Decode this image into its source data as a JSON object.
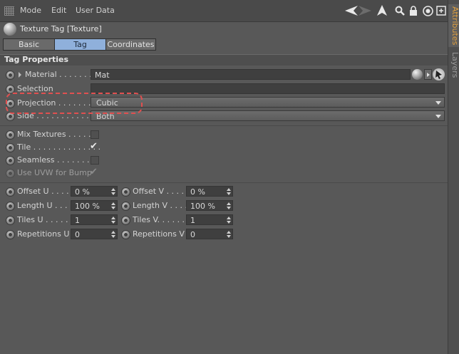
{
  "menubar": {
    "items": [
      "Mode",
      "Edit",
      "User Data"
    ]
  },
  "toolbar_icons": [
    "back-arrow-icon",
    "forward-arrow-icon",
    "cursor-up-icon",
    "search-icon",
    "lock-icon",
    "target-icon",
    "new-window-icon"
  ],
  "sidetabs": {
    "attributes": "Attributes",
    "layers": "Layers"
  },
  "header": {
    "title": "Texture Tag [Texture]"
  },
  "tabs": [
    {
      "label": "Basic"
    },
    {
      "label": "Tag",
      "active": true
    },
    {
      "label": "Coordinates"
    }
  ],
  "section": {
    "title": "Tag Properties"
  },
  "material": {
    "label": "Material . . . . . . .",
    "value": "Mat"
  },
  "selection": {
    "label": "Selection",
    "value": ""
  },
  "projection": {
    "label": "Projection . . . . . . .",
    "value": "Cubic"
  },
  "side": {
    "label": "Side . . . . . . . . . . . .",
    "value": "Both"
  },
  "mix_textures": {
    "label": "Mix Textures . . . . .",
    "checked": false
  },
  "tile": {
    "label": "Tile . . . . . . . . . . . . . .",
    "checked": true,
    "checkmark": "✔"
  },
  "seamless": {
    "label": "Seamless . . . . . . .",
    "checked": false
  },
  "use_uvw": {
    "label": "Use UVW for Bump",
    "checked": true,
    "checkmark": "✔"
  },
  "offset_u": {
    "label": "Offset U . . . .",
    "value": "0 %"
  },
  "offset_v": {
    "label": "Offset V . . . .",
    "value": "0 %"
  },
  "length_u": {
    "label": "Length U . . . .",
    "value": "100 %"
  },
  "length_v": {
    "label": "Length V . . . .",
    "value": "100 %"
  },
  "tiles_u": {
    "label": "Tiles U . . . . . .",
    "value": "1"
  },
  "tiles_v": {
    "label": "Tiles V. . . . . .",
    "value": "1"
  },
  "repetitions_u": {
    "label": "Repetitions U",
    "value": "0"
  },
  "repetitions_v": {
    "label": "Repetitions V",
    "value": "0"
  },
  "colors": {
    "accent_tab": "#8fb0db",
    "highlight": "#e05050",
    "sidetab_active": "#e0a040"
  }
}
